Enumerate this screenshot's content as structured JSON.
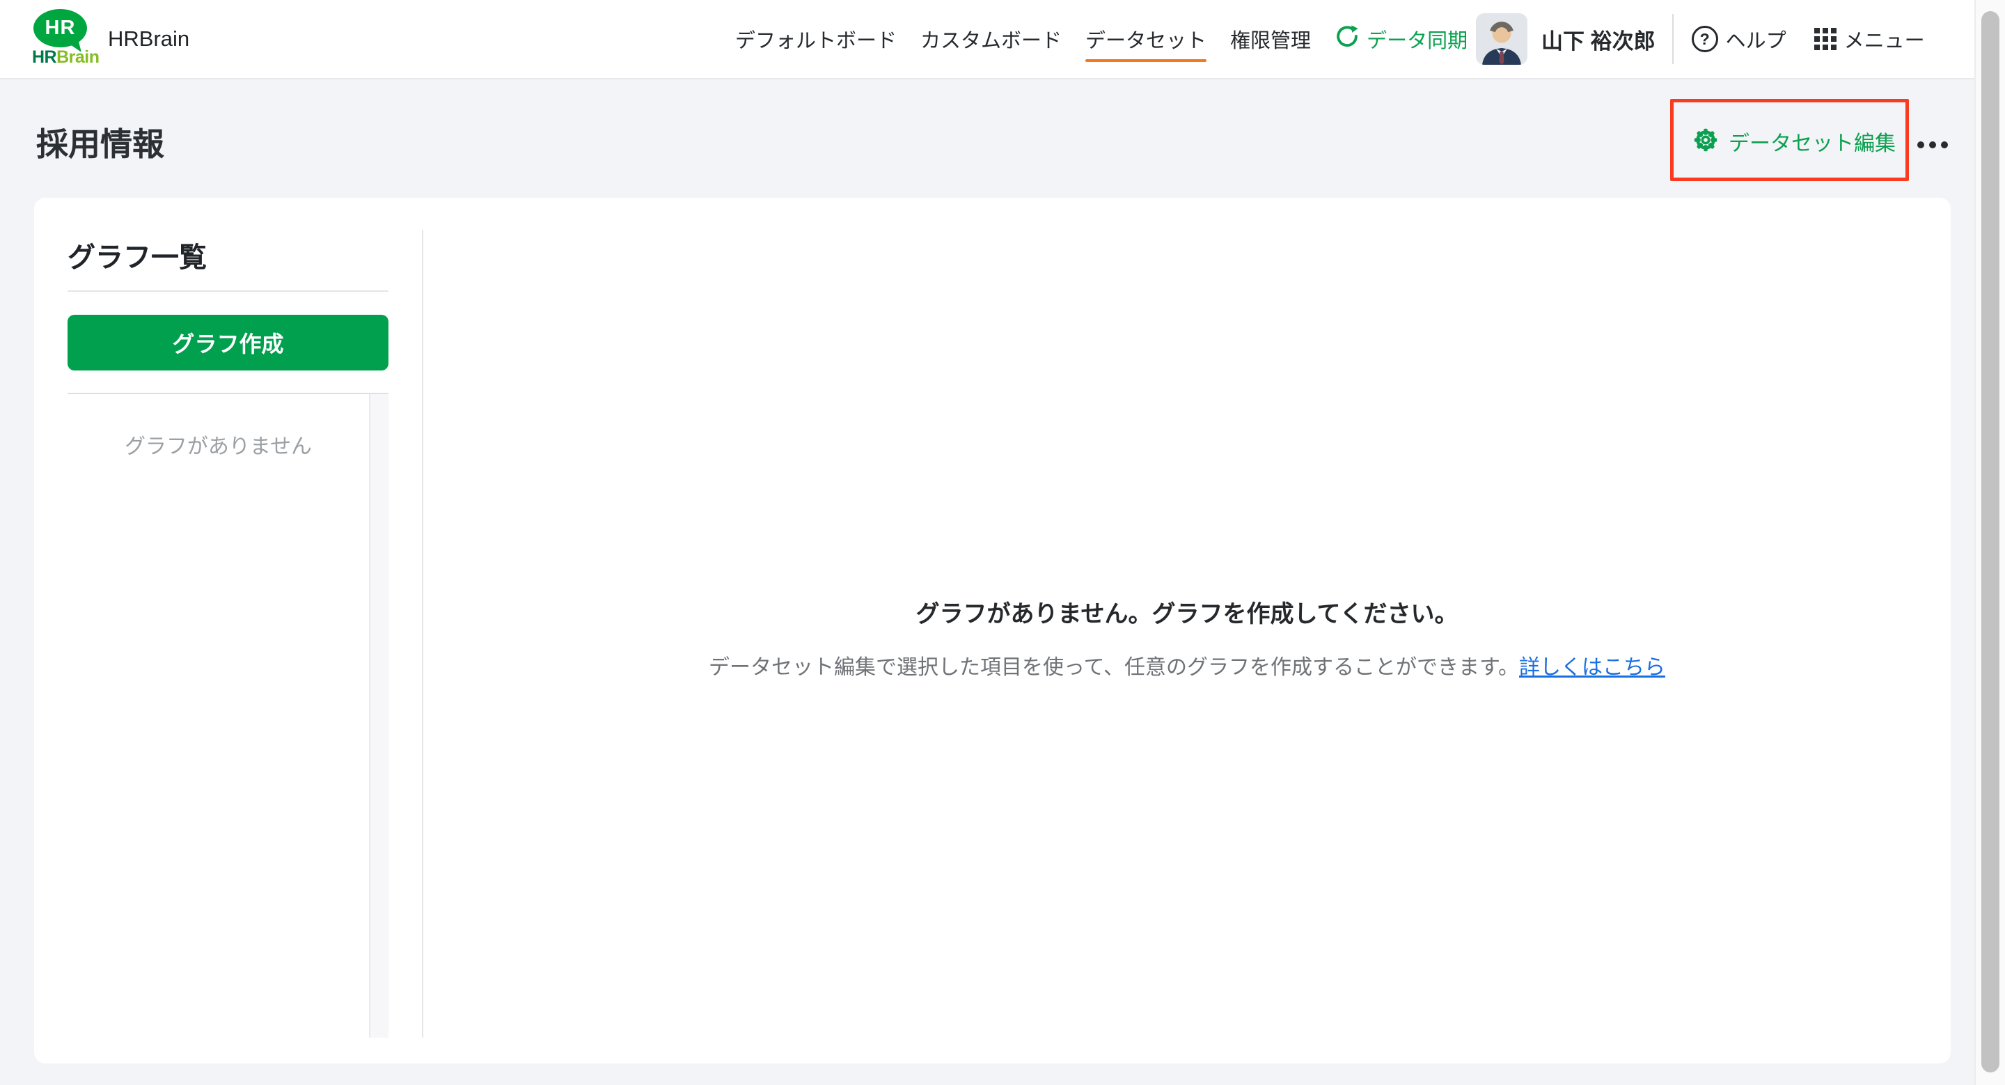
{
  "brand": {
    "bubble_text": "HR",
    "wordmark_hr": "HR",
    "wordmark_brain": "Brain",
    "app_name": "HRBrain"
  },
  "nav": {
    "items": [
      {
        "label": "デフォルトボード",
        "active": false
      },
      {
        "label": "カスタムボード",
        "active": false
      },
      {
        "label": "データセット",
        "active": true
      },
      {
        "label": "権限管理",
        "active": false
      }
    ],
    "sync_label": "データ同期"
  },
  "user": {
    "name": "山下 裕次郎"
  },
  "actions": {
    "help_glyph": "?",
    "help_label": "ヘルプ",
    "menu_label": "メニュー"
  },
  "page": {
    "title": "採用情報"
  },
  "toolbar": {
    "dataset_edit_label": "データセット編集"
  },
  "sidebar": {
    "heading": "グラフ一覧",
    "create_button_label": "グラフ作成",
    "empty_text": "グラフがありません"
  },
  "main": {
    "empty_title": "グラフがありません。グラフを作成してください。",
    "empty_description": "データセット編集で選択した項目を使って、任意のグラフを作成することができます。",
    "learn_more_label": "詳しくはこちら"
  },
  "colors": {
    "accent_green": "#00a04e",
    "logo_green": "#00a63f",
    "active_underline_orange": "#f5781e",
    "annotation_red": "#f93b22",
    "link_blue": "#1a6fe0"
  }
}
